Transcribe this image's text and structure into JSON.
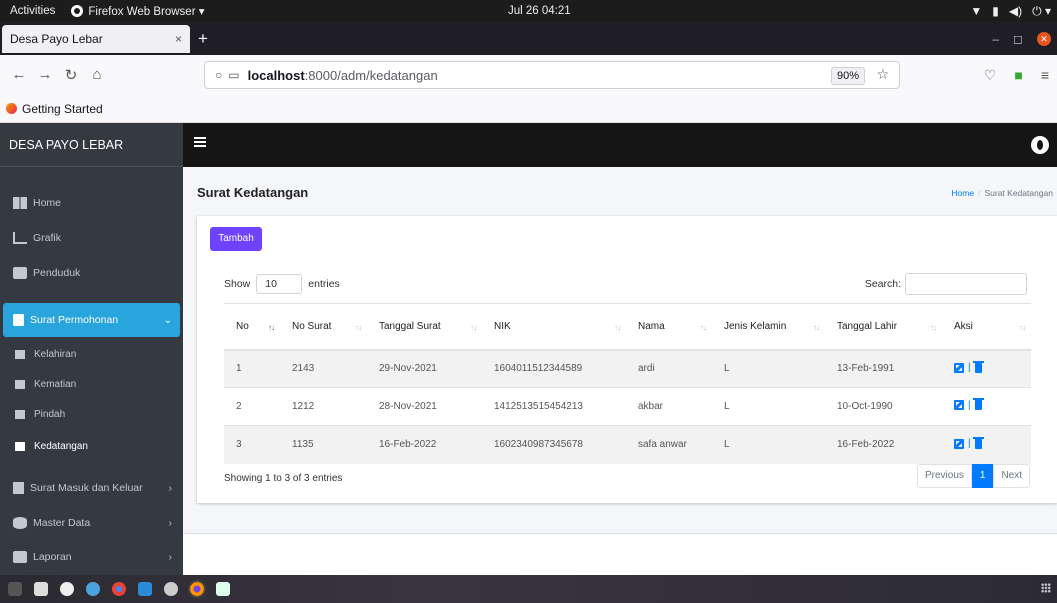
{
  "system": {
    "activities": "Activities",
    "app_name": "Firefox Web Browser ▾",
    "clock": "Jul 26  04:21"
  },
  "browser": {
    "tab_title": "Desa Payo Lebar",
    "url_host": "localhost",
    "url_path": ":8000/adm/kedatangan",
    "zoom": "90%",
    "bookmark": "Getting Started"
  },
  "sidebar": {
    "brand": "DESA PAYO LEBAR",
    "items": [
      {
        "label": "Home",
        "icon": "dashboard-icon"
      },
      {
        "label": "Grafik",
        "icon": "chart-icon"
      },
      {
        "label": "Penduduk",
        "icon": "user-plus-icon"
      },
      {
        "label": "Surat Permohonan",
        "icon": "file-icon"
      },
      {
        "label": "Kelahiran",
        "icon": "folder-icon"
      },
      {
        "label": "Kematian",
        "icon": "folder-icon"
      },
      {
        "label": "Pindah",
        "icon": "folder-icon"
      },
      {
        "label": "Kedatangan",
        "icon": "folder-icon"
      },
      {
        "label": "Surat Masuk dan Keluar",
        "icon": "file-icon"
      },
      {
        "label": "Master Data",
        "icon": "database-icon"
      },
      {
        "label": "Laporan",
        "icon": "print-icon"
      }
    ],
    "active_color": "#28a5dc"
  },
  "page": {
    "title": "Surat Kedatangan",
    "breadcrumb_home": "Home",
    "breadcrumb_current": "Surat Kedatangan",
    "add_button": "Tambah",
    "show_label": "Show",
    "entries_value": "10",
    "entries_label": "entries",
    "search_label": "Search:",
    "info": "Showing 1 to 3 of 3 entries",
    "prev": "Previous",
    "page_num": "1",
    "next": "Next"
  },
  "table": {
    "columns": [
      "No",
      "No Surat",
      "Tanggal Surat",
      "NIK",
      "Nama",
      "Jenis Kelamin",
      "Tanggal Lahir",
      "Aksi"
    ],
    "rows": [
      [
        "1",
        "2143",
        "29-Nov-2021",
        "1604011512344589",
        "ardi",
        "L",
        "13-Feb-1991"
      ],
      [
        "2",
        "1212",
        "28-Nov-2021",
        "1412513515454213",
        "akbar",
        "L",
        "10-Oct-1990"
      ],
      [
        "3",
        "1135",
        "16-Feb-2022",
        "1602340987345678",
        "safa anwar",
        "L",
        "16-Feb-2022"
      ]
    ]
  }
}
